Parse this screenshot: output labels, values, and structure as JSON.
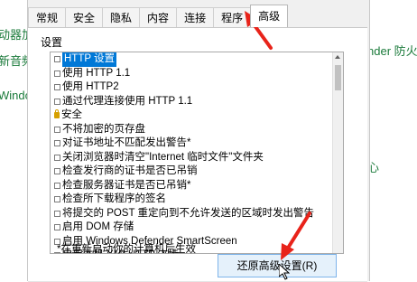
{
  "background": {
    "left_texts": [
      "动器加",
      "新音频",
      "Windo"
    ],
    "right_texts": [
      "nder 防火",
      "心"
    ]
  },
  "dialog": {
    "tabs": [
      {
        "label": "常规"
      },
      {
        "label": "安全"
      },
      {
        "label": "隐私"
      },
      {
        "label": "内容"
      },
      {
        "label": "连接"
      },
      {
        "label": "程序"
      },
      {
        "label": "高级",
        "active": true
      }
    ],
    "settings_label": "设置",
    "settings": [
      {
        "label": "HTTP 设置",
        "kind": "checkbox",
        "selected": true
      },
      {
        "label": "使用 HTTP 1.1",
        "kind": "checkbox"
      },
      {
        "label": "使用 HTTP2",
        "kind": "checkbox"
      },
      {
        "label": "通过代理连接使用 HTTP 1.1",
        "kind": "checkbox"
      },
      {
        "label": "安全",
        "kind": "category",
        "icon": "lock-icon"
      },
      {
        "label": "不将加密的页存盘",
        "kind": "checkbox"
      },
      {
        "label": "对证书地址不匹配发出警告*",
        "kind": "checkbox"
      },
      {
        "label": "关闭浏览器时清空\"Internet 临时文件\"文件夹",
        "kind": "checkbox"
      },
      {
        "label": "检查发行商的证书是否已吊销",
        "kind": "checkbox"
      },
      {
        "label": "检查服务器证书是否已吊销*",
        "kind": "checkbox"
      },
      {
        "label": "检查所下载程序的签名",
        "kind": "checkbox"
      },
      {
        "label": "将提交的 POST 重定向到不允许发送的区域时发出警告",
        "kind": "checkbox"
      },
      {
        "label": "启用 DOM 存储",
        "kind": "checkbox"
      },
      {
        "label": "启用 Windows Defender SmartScreen",
        "kind": "checkbox"
      },
      {
        "label": "启用本机 XMLHTTP 支持",
        "kind": "checkbox"
      }
    ],
    "restart_note": "*在重新启动你的计算机后生效",
    "restore_button_label": "还原高级设置(R)"
  },
  "colors": {
    "selection": "#0078d7",
    "annotation_arrow": "#e8231a",
    "background_text": "#1a7a3a"
  }
}
